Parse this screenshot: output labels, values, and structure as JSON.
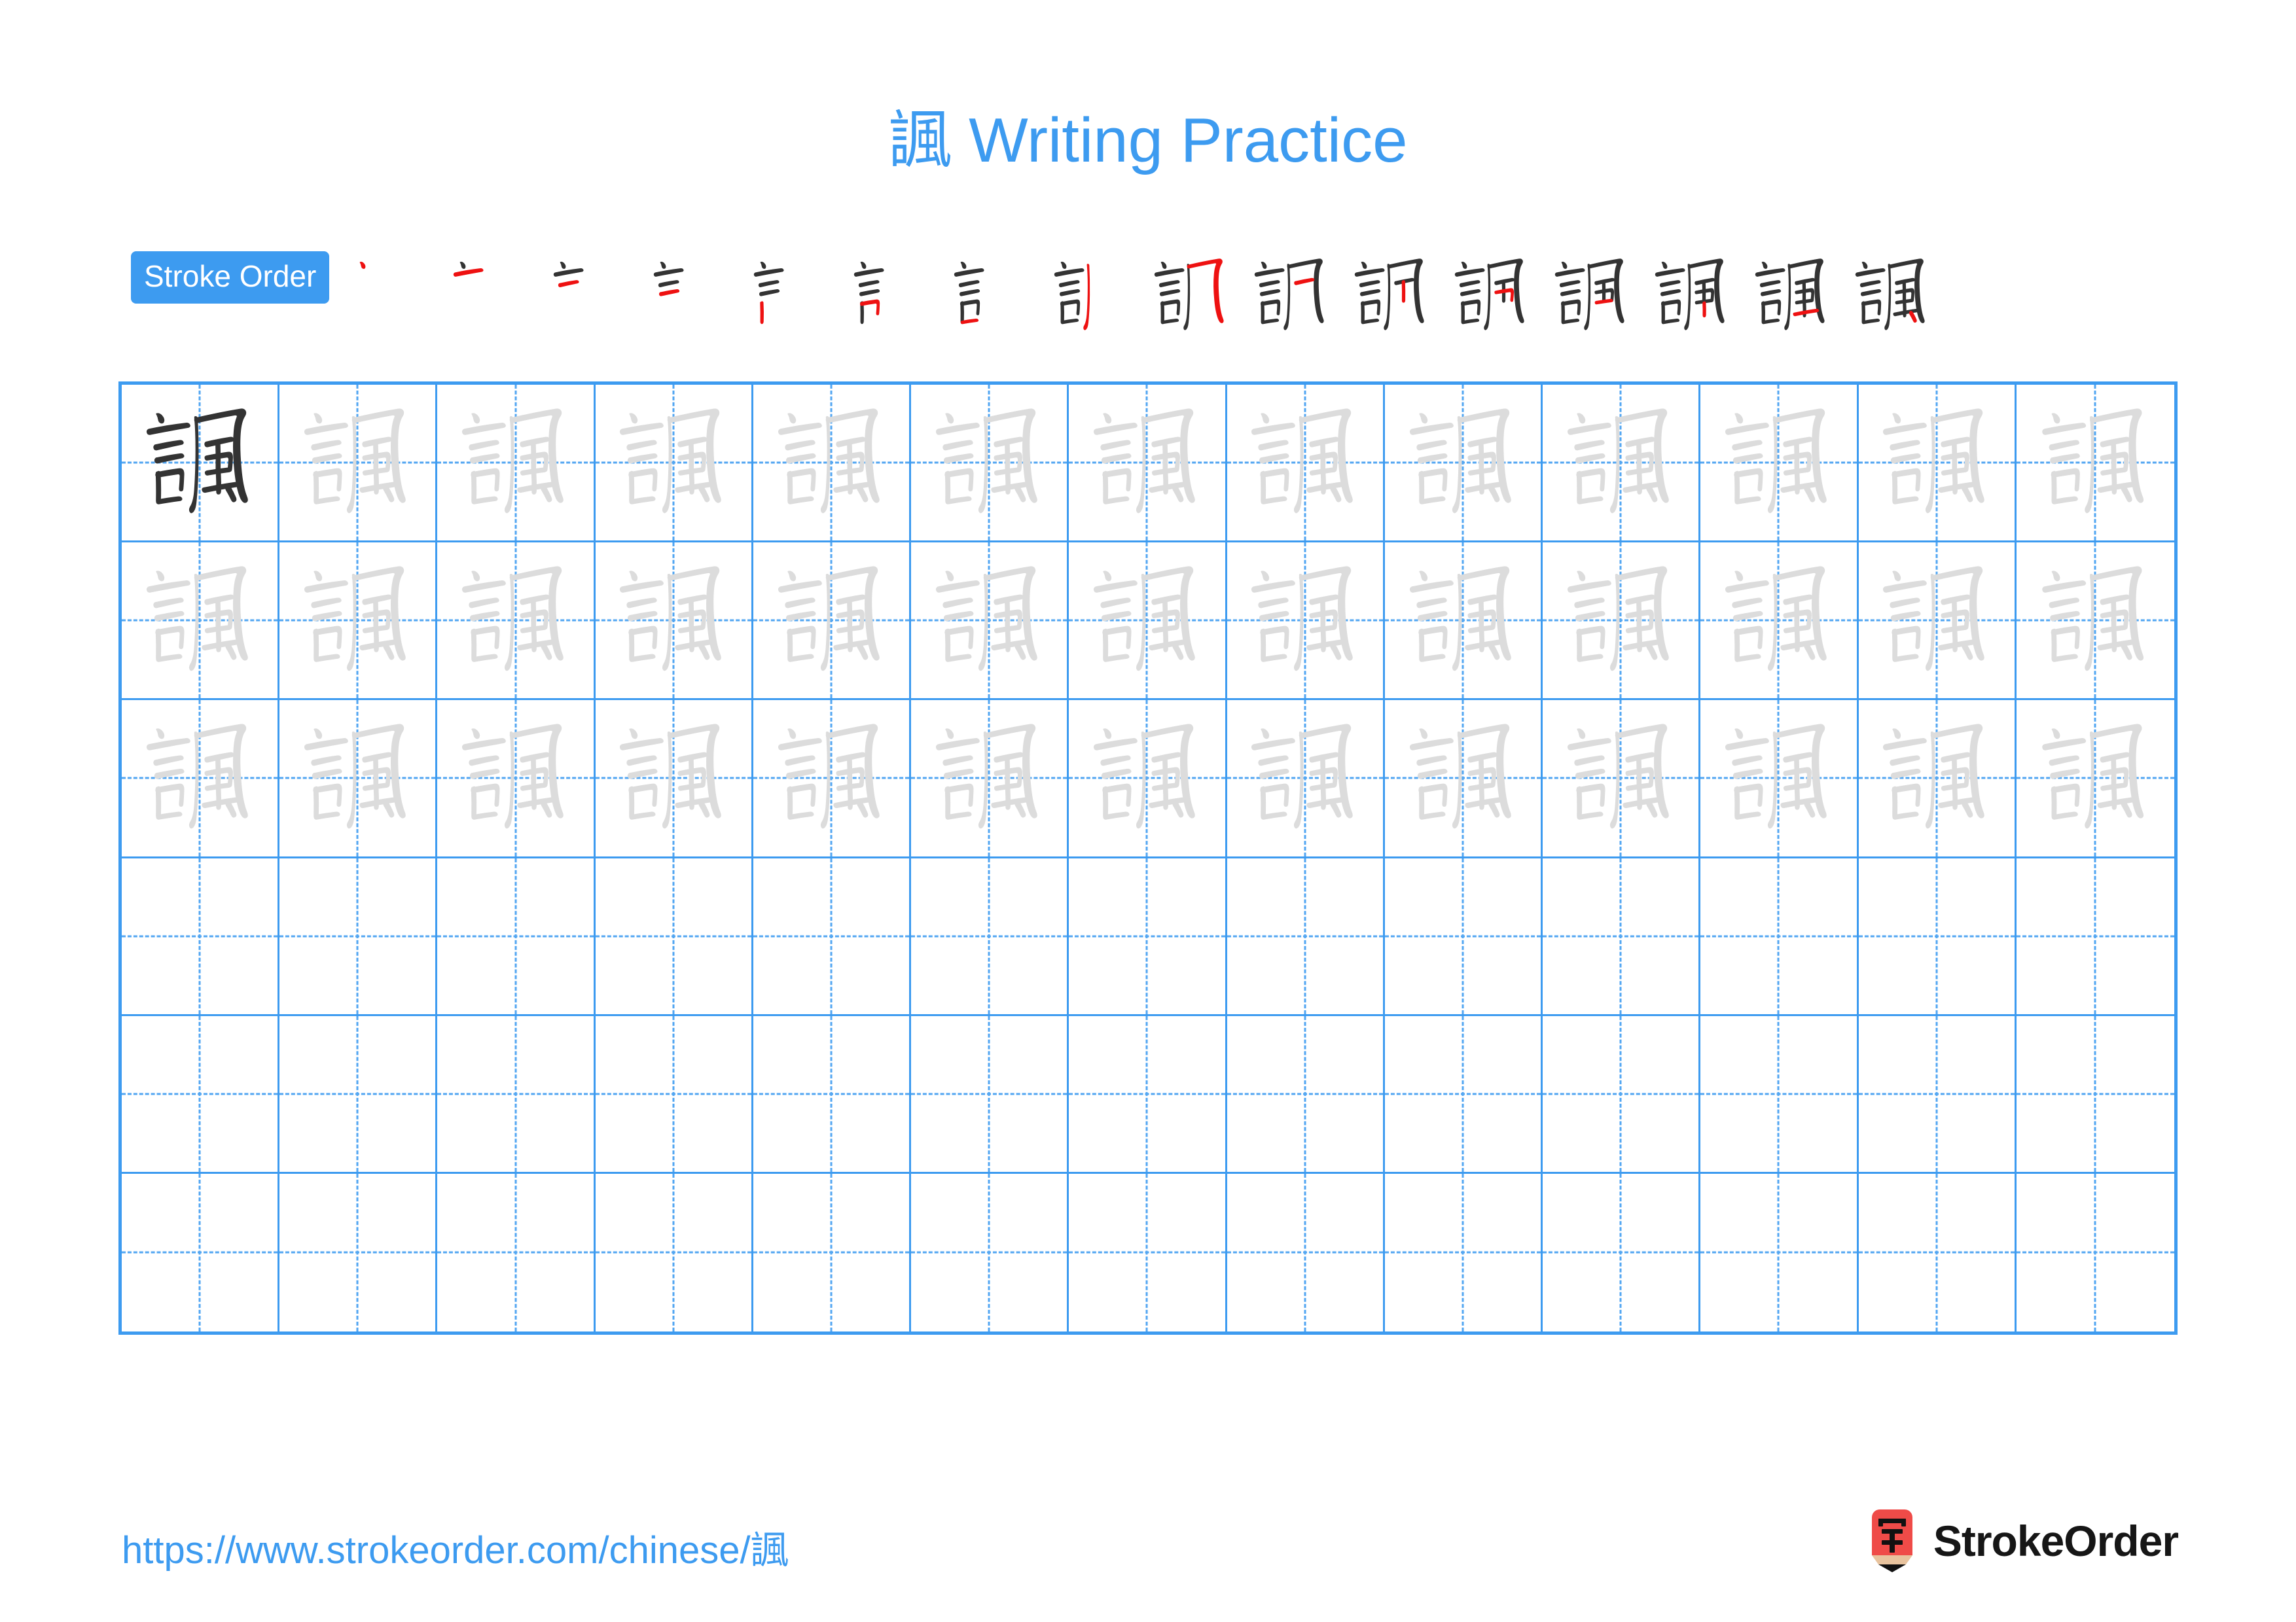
{
  "character": "諷",
  "header": {
    "title": "諷 Writing Practice"
  },
  "stroke_order": {
    "badge_label": "Stroke Order",
    "total_strokes": 16,
    "new_stroke_color": "#ee1111",
    "existing_stroke_color": "#333333",
    "steps": [
      {
        "index": 1,
        "strokes_shown": 1
      },
      {
        "index": 2,
        "strokes_shown": 2
      },
      {
        "index": 3,
        "strokes_shown": 3
      },
      {
        "index": 4,
        "strokes_shown": 4
      },
      {
        "index": 5,
        "strokes_shown": 5
      },
      {
        "index": 6,
        "strokes_shown": 6
      },
      {
        "index": 7,
        "strokes_shown": 7
      },
      {
        "index": 8,
        "strokes_shown": 8
      },
      {
        "index": 9,
        "strokes_shown": 9
      },
      {
        "index": 10,
        "strokes_shown": 10
      },
      {
        "index": 11,
        "strokes_shown": 11
      },
      {
        "index": 12,
        "strokes_shown": 12
      },
      {
        "index": 13,
        "strokes_shown": 13
      },
      {
        "index": 14,
        "strokes_shown": 14
      },
      {
        "index": 15,
        "strokes_shown": 15
      },
      {
        "index": 16,
        "strokes_shown": 16
      }
    ]
  },
  "practice_grid": {
    "columns": 13,
    "rows": 6,
    "grid_line_color": "#3d9bf0",
    "guide_line_color": "#52a6f2",
    "model_glyph_color": "#333333",
    "trace_glyph_color": "#dcdcdc",
    "row_fill": [
      "model-then-trace",
      "trace",
      "trace",
      "empty",
      "empty",
      "empty"
    ]
  },
  "footer": {
    "url": "https://www.strokeorder.com/chinese/諷",
    "brand_name": "StrokeOrder",
    "brand_mark_char": "字",
    "brand_mark_color": "#ef4b48",
    "brand_mark_tip_color": "#e8c39e"
  }
}
